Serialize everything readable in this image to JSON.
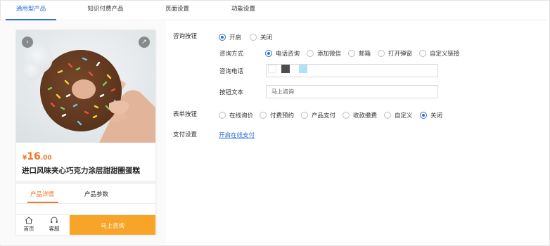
{
  "tabs": [
    {
      "label": "通用型产品",
      "active": true
    },
    {
      "label": "知识付费产品",
      "active": false
    },
    {
      "label": "页面设置",
      "active": false
    },
    {
      "label": "功能设置",
      "active": false
    }
  ],
  "preview": {
    "price_currency": "¥",
    "price_int": "16",
    "price_dec": ".00",
    "title": "进口风味夹心巧克力涂层甜甜圈蛋糕",
    "tabs": [
      "产品详情",
      "产品参数"
    ],
    "bottom_home": "首页",
    "bottom_service": "客服",
    "bottom_cta": "马上咨询"
  },
  "form": {
    "consult_button": {
      "label": "咨询按钮",
      "options": [
        "开启",
        "关闭"
      ],
      "selected": "开启"
    },
    "consult_method": {
      "label": "咨询方式",
      "options": [
        "电话咨询",
        "添加微信",
        "邮箱",
        "打开弹窗",
        "自定义链接"
      ],
      "selected": "电话咨询"
    },
    "consult_phone": {
      "label": "咨询电话",
      "colors": [
        "#ffffff",
        "#4d4d4d",
        "#aee3f7"
      ]
    },
    "button_text": {
      "label": "按钮文本",
      "value": "马上咨询"
    },
    "form_button": {
      "label": "表单按钮",
      "options": [
        "在线询价",
        "付费预约",
        "产品支付",
        "收款缴费",
        "自定义",
        "关闭"
      ],
      "selected": "关闭"
    },
    "payment": {
      "label": "支付设置",
      "link": "开启在线支付"
    }
  },
  "colors": {
    "accent": "#2f6fd6",
    "orange": "#f07422",
    "cta": "#f7a428"
  }
}
